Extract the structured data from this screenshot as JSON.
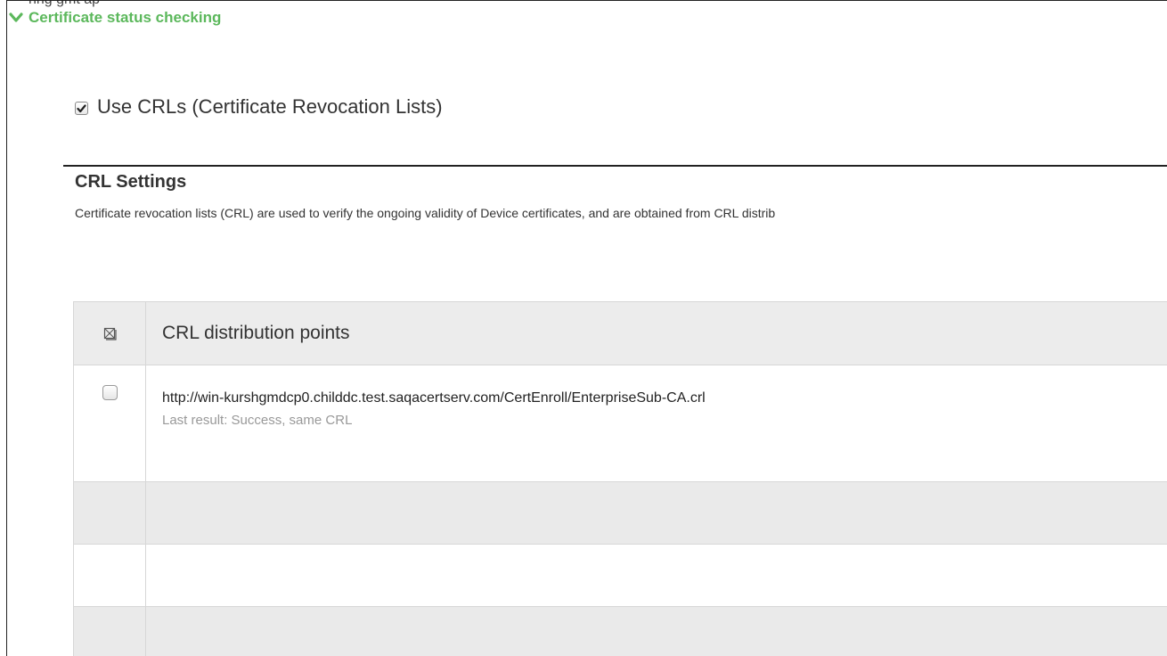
{
  "header_fragment": "ring gmt ap",
  "section": {
    "title": "Certificate status checking",
    "collapse_icon": "chevron-down-icon",
    "accent_color": "#5cb85c"
  },
  "use_crls": {
    "label": "Use CRLs (Certificate Revocation Lists)",
    "checked": true
  },
  "crl_settings": {
    "title": "CRL Settings",
    "description": "Certificate revocation lists (CRL) are used to verify the ongoing validity of Device certificates, and are obtained from CRL distrib"
  },
  "table": {
    "select_all_icon": "select-all-icon",
    "header": "CRL distribution points",
    "rows": [
      {
        "url": "http://win-kurshgmdcp0.childdc.test.saqacertserv.com/CertEnroll/EnterpriseSub-CA.crl",
        "result": "Last result: Success, same CRL",
        "checked": false
      }
    ]
  }
}
